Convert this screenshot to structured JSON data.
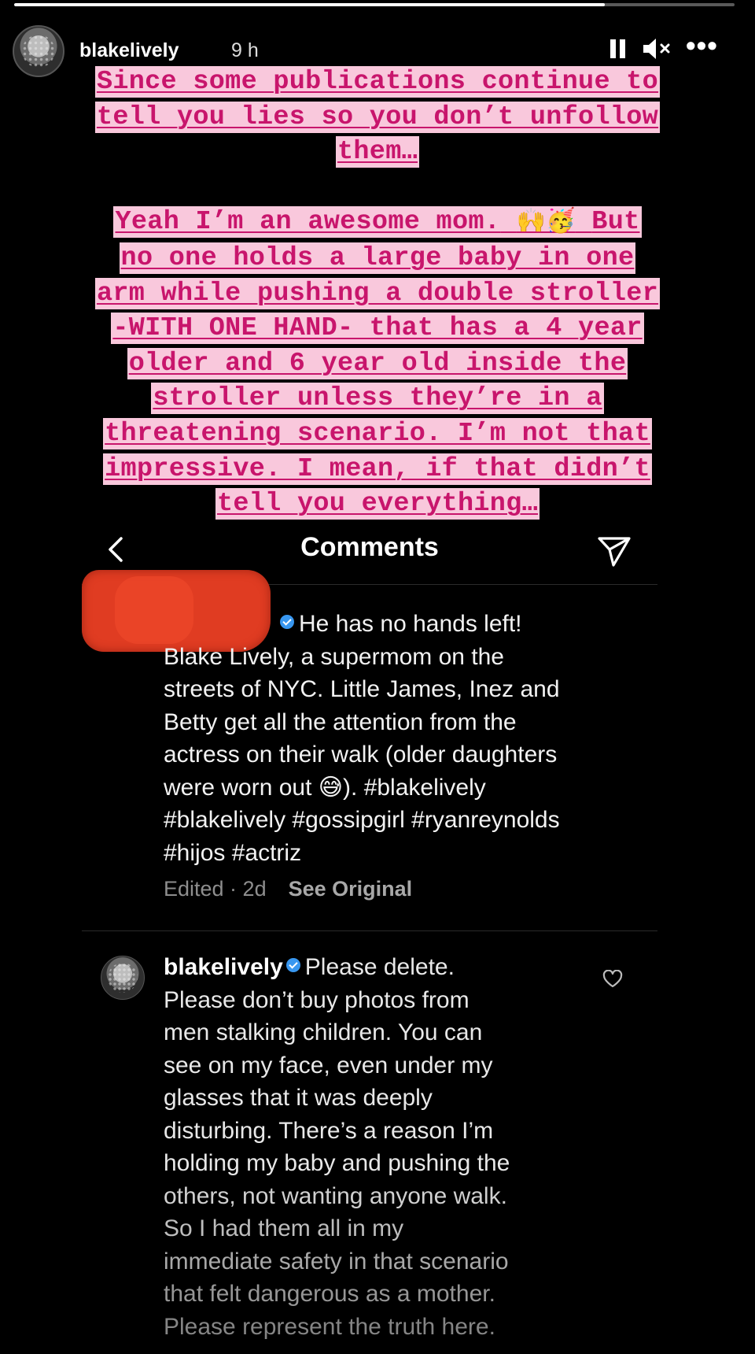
{
  "story": {
    "progress": 0.82,
    "username": "blakelively",
    "time": "9 h",
    "more_label": "•••"
  },
  "caption": {
    "para1": [
      "Since some publications continue to",
      "tell you lies so you don’t unfollow",
      "them…"
    ],
    "para2_line1_before": "Yeah I’m an awesome mom.",
    "para2_emojis": "🙌🥳",
    "para2_line1_after": "But",
    "para2": [
      "no one holds a large baby in one",
      "arm while pushing a double stroller",
      "-WITH ONE HAND- that has a 4 year",
      "older and 6 year old inside the",
      "stroller unless they’re in a",
      "threatening scenario. I’m not that",
      "impressive. I mean, if that didn’t",
      "tell you everything…"
    ]
  },
  "comments_header": {
    "title": "Comments"
  },
  "comment1": {
    "lines": [
      "He has no hands left!",
      "Blake Lively, a supermom on the",
      "streets of NYC. Little James, Inez and",
      "Betty get all the attention from the",
      "actress on their walk (older daughters",
      "were worn out 😅). #blakelively",
      "#blakelively #gossipgirl #ryanreynolds",
      "#hijos #actriz"
    ],
    "meta": "Edited · 2d",
    "see_original": "See Original"
  },
  "comment2": {
    "username": "blakelively",
    "first": "Please delete.",
    "lines": [
      "Please don’t buy photos from",
      "men stalking children. You can",
      "see on my face, even under my",
      "glasses that it was deeply",
      "disturbing. There’s a reason I’m",
      "holding my baby and pushing the",
      "others, not wanting anyone walk.",
      "So I had them all in my",
      "immediate safety in that scenario",
      "that felt dangerous as a mother.",
      "Please represent the truth here."
    ]
  }
}
